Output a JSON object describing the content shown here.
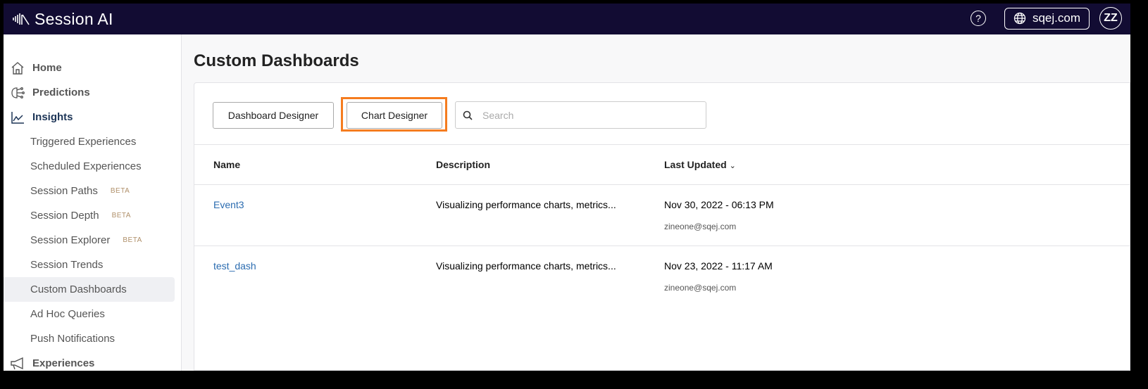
{
  "header": {
    "app_name": "Session AI",
    "domain": "sqej.com",
    "avatar": "ZZ",
    "help": "?"
  },
  "sidebar": {
    "home": "Home",
    "predictions": "Predictions",
    "insights": "Insights",
    "subitems": [
      {
        "label": "Triggered Experiences"
      },
      {
        "label": "Scheduled Experiences"
      },
      {
        "label": "Session Paths",
        "badge": "BETA"
      },
      {
        "label": "Session Depth",
        "badge": "BETA"
      },
      {
        "label": "Session Explorer",
        "badge": "BETA"
      },
      {
        "label": "Session Trends"
      },
      {
        "label": "Custom Dashboards"
      },
      {
        "label": "Ad Hoc Queries"
      },
      {
        "label": "Push Notifications"
      }
    ],
    "experiences": "Experiences"
  },
  "main": {
    "title": "Custom Dashboards",
    "dashboard_designer": "Dashboard Designer",
    "chart_designer": "Chart Designer",
    "search_placeholder": "Search",
    "columns": {
      "name": "Name",
      "description": "Description",
      "last_updated": "Last Updated"
    },
    "rows": [
      {
        "name": "Event3",
        "description": "Visualizing performance charts, metrics...",
        "updated": "Nov 30, 2022 - 06:13 PM",
        "by": "zineone@sqej.com"
      },
      {
        "name": "test_dash",
        "description": "Visualizing performance charts, metrics...",
        "updated": "Nov 23, 2022 - 11:17 AM",
        "by": "zineone@sqej.com"
      }
    ]
  }
}
